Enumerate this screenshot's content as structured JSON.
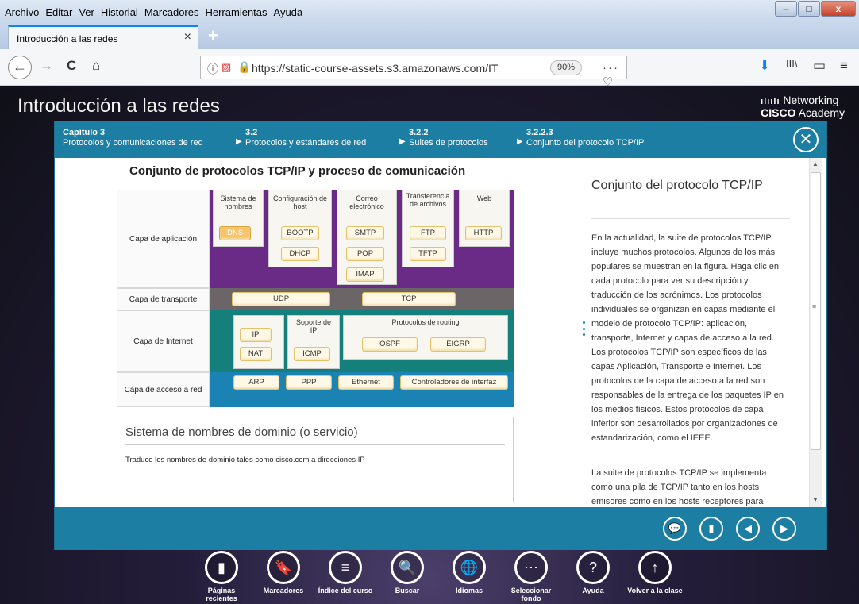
{
  "browser": {
    "menu": [
      "Archivo",
      "Editar",
      "Ver",
      "Historial",
      "Marcadores",
      "Herramientas",
      "Ayuda"
    ],
    "window_controls": [
      "–",
      "□",
      "x"
    ],
    "tab_title": "Introducción a las redes",
    "tab_close": "×",
    "new_tab": "+",
    "url": "https://static-course-assets.s3.amazonaws.com/IT",
    "zoom": "90%",
    "url_actions": "··· ♡ ☆",
    "icons": {
      "back": "←",
      "forward": "→",
      "reload": "C",
      "home": "⌂",
      "download": "⬇",
      "library": "III\\",
      "sidebar": "▭",
      "menu": "≡"
    }
  },
  "course": {
    "title": "Introducción a las redes",
    "brand_bars": "ılıılı",
    "brand_networking": "Networking",
    "brand_cisco": "CISCO",
    "brand_academy": "Academy"
  },
  "breadcrumb": [
    {
      "num": "Capítulo 3",
      "label": "Protocolos y comunicaciones de red"
    },
    {
      "num": "3.2",
      "label": "Protocolos y estándares de red"
    },
    {
      "num": "3.2.2",
      "label": "Suites de protocolos"
    },
    {
      "num": "3.2.2.3",
      "label": "Conjunto del protocolo TCP/IP"
    }
  ],
  "figure": {
    "title": "Conjunto de protocolos TCP/IP y proceso de comunicación",
    "layers": {
      "application": "Capa de aplicación",
      "transport": "Capa de transporte",
      "internet": "Capa de Internet",
      "access": "Capa de acceso a red"
    },
    "groups": {
      "names": "Sistema de nombres",
      "host_config": "Configuración de host",
      "email": "Correo electrónico",
      "file_transfer": "Transferencia de archivos",
      "web": "Web",
      "ip_support": "Soporte de IP",
      "routing": "Protocolos de routing"
    },
    "protocols": {
      "dns": "DNS",
      "bootp": "BOOTP",
      "dhcp": "DHCP",
      "smtp": "SMTP",
      "pop": "POP",
      "imap": "IMAP",
      "ftp": "FTP",
      "tftp": "TFTP",
      "http": "HTTP",
      "udp": "UDP",
      "tcp": "TCP",
      "ip": "IP",
      "nat": "NAT",
      "icmp": "ICMP",
      "ospf": "OSPF",
      "eigrp": "EIGRP",
      "arp": "ARP",
      "ppp": "PPP",
      "ethernet": "Ethernet",
      "drivers": "Controladores de interfaz"
    },
    "description": {
      "title": "Sistema de nombres de dominio (o servicio)",
      "text": "Traduce los nombres de dominio tales como cisco.com a direcciones IP"
    }
  },
  "panel": {
    "title": "Conjunto del protocolo TCP/IP",
    "p1": "En la actualidad, la suite de protocolos TCP/IP incluye muchos protocolos. Algunos de los más populares se muestran en la figura. Haga clic en cada protocolo para ver su descripción y traducción de los acrónimos. Los protocolos individuales se organizan en capas mediante el modelo de protocolo TCP/IP: aplicación, transporte, Internet y capas de acceso a la red. Los protocolos TCP/IP son específicos de las capas Aplicación, Transporte e Internet. Los protocolos de la capa de acceso a la red son responsables de la entrega de los paquetes IP en los medios físicos. Estos protocolos de capa inferior son desarrollados por organizaciones de estandarización, como el IEEE.",
    "p2": "La suite de protocolos TCP/IP se implementa como una pila de TCP/IP tanto en los hosts emisores como en los hosts receptores para proporcionar una entrega completa de las"
  },
  "dock": [
    {
      "icon": "▮",
      "label": "Páginas recientes"
    },
    {
      "icon": "🔖",
      "label": "Marcadores"
    },
    {
      "icon": "≡",
      "label": "Índice del curso"
    },
    {
      "icon": "🔍",
      "label": "Buscar"
    },
    {
      "icon": "🌐",
      "label": "Idiomas"
    },
    {
      "icon": "⋯",
      "label": "Seleccionar fondo"
    },
    {
      "icon": "?",
      "label": "Ayuda"
    },
    {
      "icon": "↑",
      "label": "Volver a la clase"
    }
  ],
  "colors": {
    "header_blue": "#1d7ea3",
    "app_purple": "#6a2b86",
    "transport_gray": "#6b6568",
    "internet_teal": "#157f7c",
    "access_blue": "#1b83b3",
    "active_protocol": "#f5c46b"
  }
}
